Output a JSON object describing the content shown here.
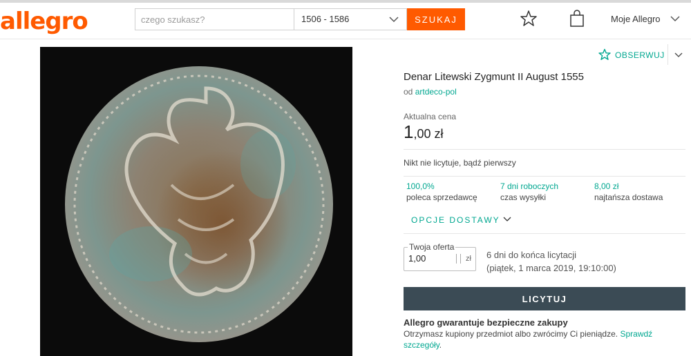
{
  "header": {
    "logo": "allegro",
    "search_placeholder": "czego szukasz?",
    "category": "1506 - 1586",
    "search_button": "SZUKAJ",
    "my_account": "Moje Allegro"
  },
  "product": {
    "watch_label": "OBSERWUJ",
    "title": "Denar Litewski Zygmunt II August 1555",
    "seller_prefix": "od",
    "seller_name": "artdeco-pol",
    "price_label": "Aktualna cena",
    "price_integer": "1",
    "price_fraction": ",00 zł",
    "bids_info": "Nikt nie licytuje, bądź pierwszy",
    "stats": [
      {
        "value": "100,0%",
        "label": "poleca sprzedawcę"
      },
      {
        "value": "7 dni roboczych",
        "label": "czas wysyłki"
      },
      {
        "value": "8,00 zł",
        "label": "najtańsza dostawa"
      }
    ],
    "delivery_options": "OPCJE DOSTAWY",
    "offer_label": "Twoja oferta",
    "offer_value": "1,00",
    "offer_currency": "zł",
    "ends_line1": "6 dni do końca licytacji",
    "ends_line2": "(piątek, 1 marca 2019, 19:10:00)",
    "bid_button": "LICYTUJ",
    "guarantee_title": "Allegro gwarantuje bezpieczne zakupy",
    "guarantee_text": "Otrzymasz kupiony przedmiot albo zwrócimy Ci pieniądze.",
    "guarantee_link": "Sprawdź szczegóły",
    "guarantee_end": "."
  },
  "icons": {
    "star": "star-icon",
    "bag": "shopping-bag-icon",
    "chevron": "chevron-down-icon"
  }
}
